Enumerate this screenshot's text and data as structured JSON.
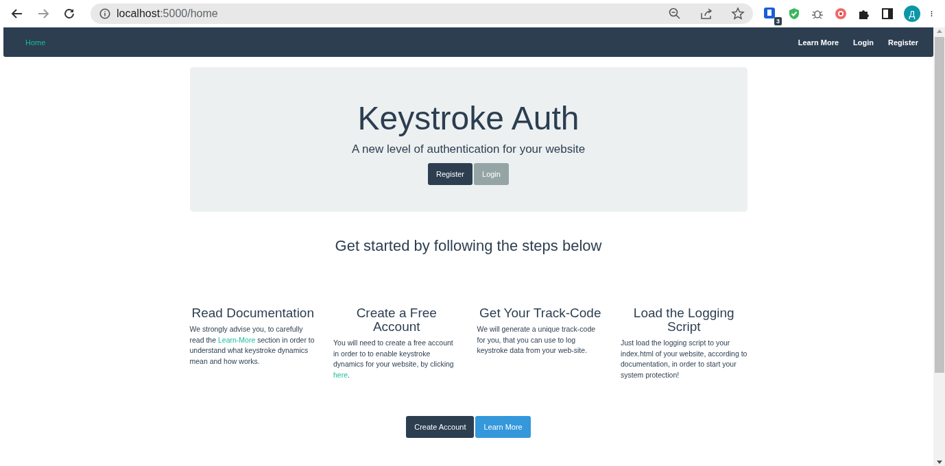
{
  "browser": {
    "url_host": "localhost",
    "url_path": ":5000/home",
    "extension_badge": "3",
    "avatar_letter": "Д"
  },
  "navbar": {
    "brand": "Home",
    "links": [
      "Learn More",
      "Login",
      "Register"
    ]
  },
  "hero": {
    "title": "Keystroke Auth",
    "subtitle": "A new level of authentication for your website",
    "buttons": [
      {
        "label": "Register",
        "kind": "primary"
      },
      {
        "label": "Login",
        "kind": "secondary"
      }
    ]
  },
  "steps_heading": "Get started by following the steps below",
  "steps": [
    {
      "title": "Read Documentation",
      "text": [
        {
          "kind": "text",
          "value": "We strongly advise you, to carefully read the "
        },
        {
          "kind": "link",
          "value": "Learn-More"
        },
        {
          "kind": "text",
          "value": " section in order to understand what keystroke dynamics mean and how works."
        }
      ]
    },
    {
      "title": "Create a Free Account",
      "text": [
        {
          "kind": "text",
          "value": "You will need to create a free account in order to to enable keystroke dynamics for your website, by clicking "
        },
        {
          "kind": "link",
          "value": "here"
        },
        {
          "kind": "text",
          "value": "."
        }
      ]
    },
    {
      "title": "Get Your Track-Code",
      "text": [
        {
          "kind": "text",
          "value": "We will generate a unique track-code for you, that you can use to log keystroke data from your web-site."
        }
      ]
    },
    {
      "title": "Load the Logging Script",
      "text": [
        {
          "kind": "text",
          "value": "Just load the logging script to your index.html of your website, according to documentation, in order to start your system protection!"
        }
      ]
    }
  ],
  "bottom_buttons": [
    {
      "label": "Create Account",
      "kind": "primary"
    },
    {
      "label": "Learn More",
      "kind": "info"
    }
  ]
}
